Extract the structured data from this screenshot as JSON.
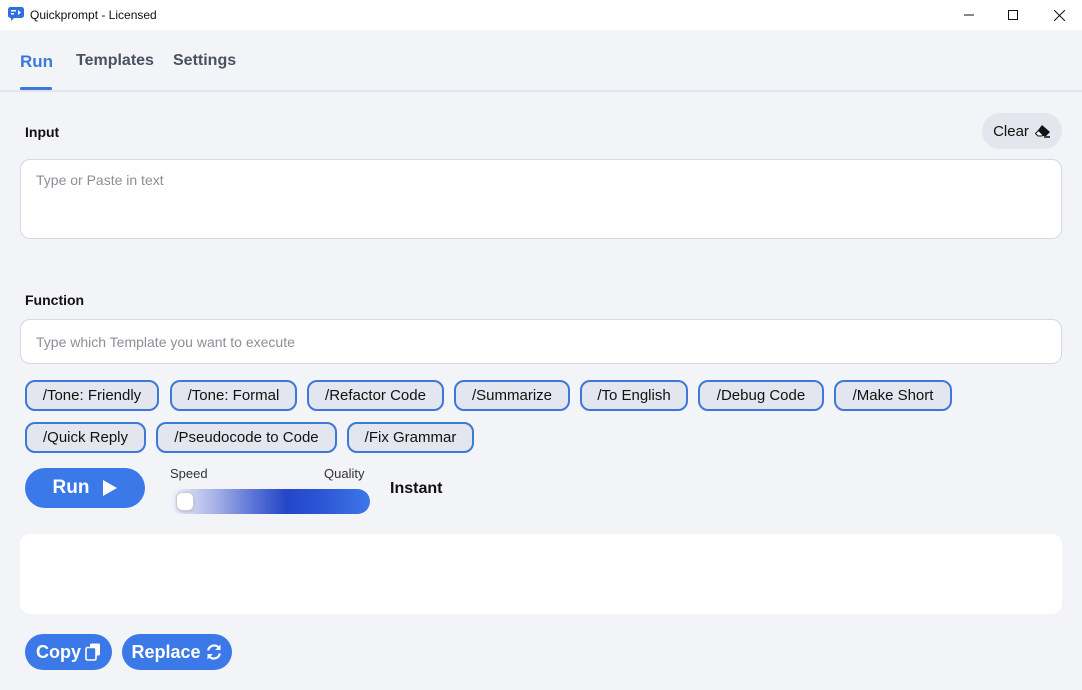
{
  "window": {
    "title": "Quickprompt - Licensed",
    "controls": [
      "minimize-icon",
      "maximize-icon",
      "close-icon"
    ]
  },
  "tabs": [
    {
      "label": "Run",
      "active": true
    },
    {
      "label": "Templates",
      "active": false
    },
    {
      "label": "Settings",
      "active": false
    }
  ],
  "input": {
    "label": "Input",
    "placeholder": "Type or Paste in text",
    "value": "",
    "clear_label": "Clear",
    "clear_icon": "eraser-icon"
  },
  "function": {
    "label": "Function",
    "placeholder": "Type which Template you want to execute",
    "value": "",
    "templates": [
      "/Tone: Friendly",
      "/Tone: Formal",
      "/Refactor Code",
      "/Summarize",
      "/To English",
      "/Debug Code",
      "/Make Short",
      "/Quick Reply",
      "/Pseudocode to Code",
      "/Fix Grammar"
    ]
  },
  "run": {
    "label": "Run",
    "icon": "play-icon"
  },
  "slider": {
    "left_label": "Speed",
    "right_label": "Quality",
    "value_fraction": 0,
    "value_label": "Instant"
  },
  "output": {
    "value": ""
  },
  "actions": {
    "copy_label": "Copy",
    "copy_icon": "copy-icon",
    "replace_label": "Replace",
    "replace_icon": "refresh-icon"
  },
  "colors": {
    "accent": "#3b78e8",
    "tab_active": "#3b78d8",
    "chip_border": "#3b78d8",
    "background": "#f3f4f8"
  }
}
